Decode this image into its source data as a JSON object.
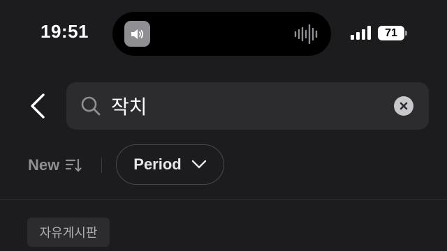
{
  "status_bar": {
    "time": "19:51",
    "battery_level": "71",
    "icons": [
      "speaker-icon",
      "waveform-icon",
      "signal-icon",
      "battery-icon"
    ]
  },
  "search": {
    "query": "작치",
    "icons": [
      "back-icon",
      "search-icon",
      "clear-icon"
    ]
  },
  "filters": {
    "sort_label": "New",
    "period_label": "Period",
    "icons": [
      "sort-icon",
      "chevron-down-icon"
    ]
  },
  "results": {
    "board_tag": "자유게시판"
  },
  "colors": {
    "background": "#1c1c1e",
    "surface": "#2c2c2e",
    "muted_text": "#8e8e93"
  }
}
